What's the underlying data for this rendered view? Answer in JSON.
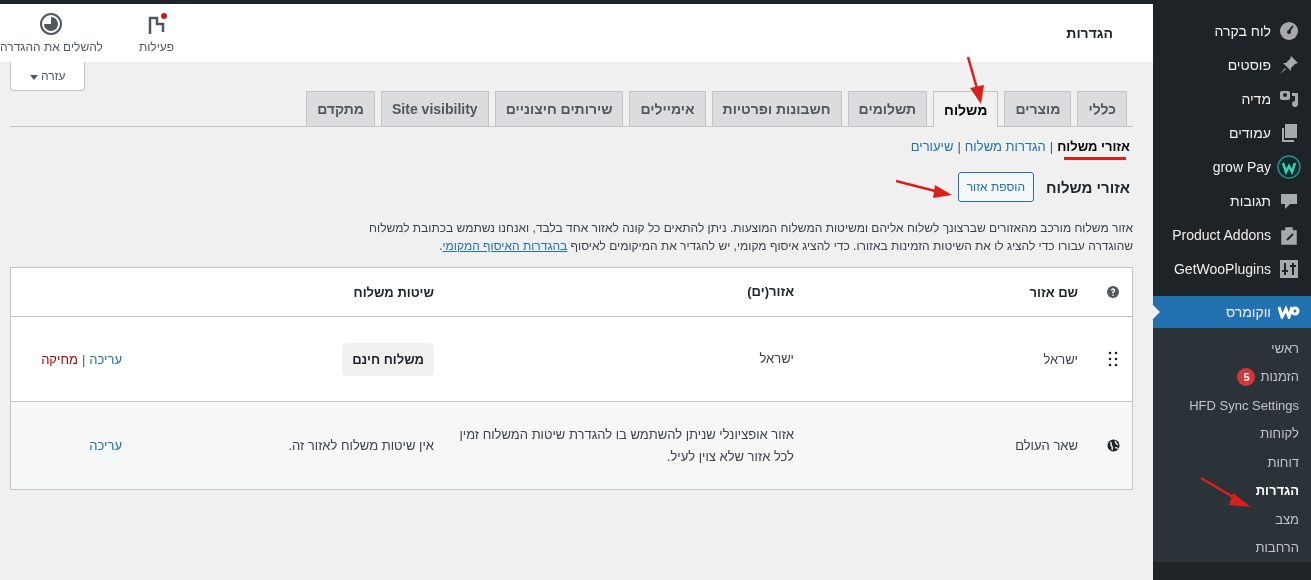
{
  "header": {
    "title": "הגדרות",
    "actions": [
      {
        "label": "פעילות",
        "kind": "activity"
      },
      {
        "label": "להשלים את ההגדרה",
        "kind": "progress"
      }
    ]
  },
  "help_button": "עזרה",
  "tabs": [
    {
      "label": "כללי",
      "selected": false
    },
    {
      "label": "מוצרים",
      "selected": false
    },
    {
      "label": "משלוח",
      "selected": true
    },
    {
      "label": "תשלומים",
      "selected": false
    },
    {
      "label": "חשבונות ופרטיות",
      "selected": false
    },
    {
      "label": "אימיילים",
      "selected": false
    },
    {
      "label": "שירותים חיצוניים",
      "selected": false
    },
    {
      "label": "Site visibility",
      "selected": false
    },
    {
      "label": "מתקדם",
      "selected": false
    }
  ],
  "subnav_separator": "|",
  "subnav": [
    {
      "label": "אזורי משלוח",
      "selected": true
    },
    {
      "label": "הגדרות משלוח",
      "selected": false
    },
    {
      "label": "שיעורים",
      "selected": false
    }
  ],
  "section": {
    "title": "אזורי משלוח",
    "add_button": "הוספת אזור",
    "description": "אזור משלוח מורכב מהאזורים שברצונך לשלוח אליהם ומשיטות המשלוח המוצעות. ניתן להתאים כל קונה לאזור אחד בלבד, ואנחנו נשתמש בכתובת למשלוח שהוגדרה עבורו כדי להציג לו את השיטות הזמינות באזורו. כדי להציג איסוף מקומי, יש להגדיר את המיקומים לאיסוף",
    "description_link": "בהגדרות האיסוף המקומי",
    "description_end": "."
  },
  "table": {
    "columns": [
      "שם אזור",
      "אזור(ים)",
      "שיטות משלוח"
    ],
    "rows": [
      {
        "kind": "zone",
        "name": "ישראל",
        "regions": "ישראל",
        "methods": [
          "משלוח חינם"
        ],
        "action_separator": "|",
        "actions": [
          {
            "label": "עריכה",
            "kind": "edit"
          },
          {
            "label": "מחיקה",
            "kind": "delete"
          }
        ]
      },
      {
        "kind": "rest",
        "name": "שאר העולם",
        "regions": "אזור אופציונלי שניתן להשתמש בו להגדרת שיטות המשלוח זמין לכל אזור שלא צוין לעיל.",
        "methods_note": "אין שיטות משלוח לאזור זה.",
        "actions": [
          {
            "label": "עריכה",
            "kind": "edit"
          }
        ]
      }
    ]
  },
  "sidebar": {
    "items": [
      {
        "label": "לוח בקרה",
        "kind": "dashboard",
        "selected": false
      },
      {
        "label": "פוסטים",
        "kind": "pin",
        "selected": false
      },
      {
        "label": "מדיה",
        "kind": "media",
        "selected": false
      },
      {
        "label": "עמודים",
        "kind": "pages",
        "selected": false
      },
      {
        "label": "grow Pay",
        "kind": "grow",
        "selected": false
      },
      {
        "label": "תגובות",
        "kind": "comments",
        "selected": false
      },
      {
        "label": "Product Addons",
        "kind": "addons",
        "selected": false
      },
      {
        "label": "GetWooPlugins",
        "kind": "plugins",
        "selected": false
      },
      {
        "label": "ווקומרס",
        "kind": "woo",
        "selected": true
      }
    ],
    "submenu": [
      {
        "label": "ראשי",
        "selected": false
      },
      {
        "label": "הזמנות",
        "badge": "5",
        "selected": false
      },
      {
        "label": "HFD Sync Settings",
        "selected": false
      },
      {
        "label": "לקוחות",
        "selected": false
      },
      {
        "label": "דוחות",
        "selected": false
      },
      {
        "label": "הגדרות",
        "selected": true
      },
      {
        "label": "מצב",
        "selected": false
      },
      {
        "label": "הרחבות",
        "selected": false
      }
    ]
  }
}
